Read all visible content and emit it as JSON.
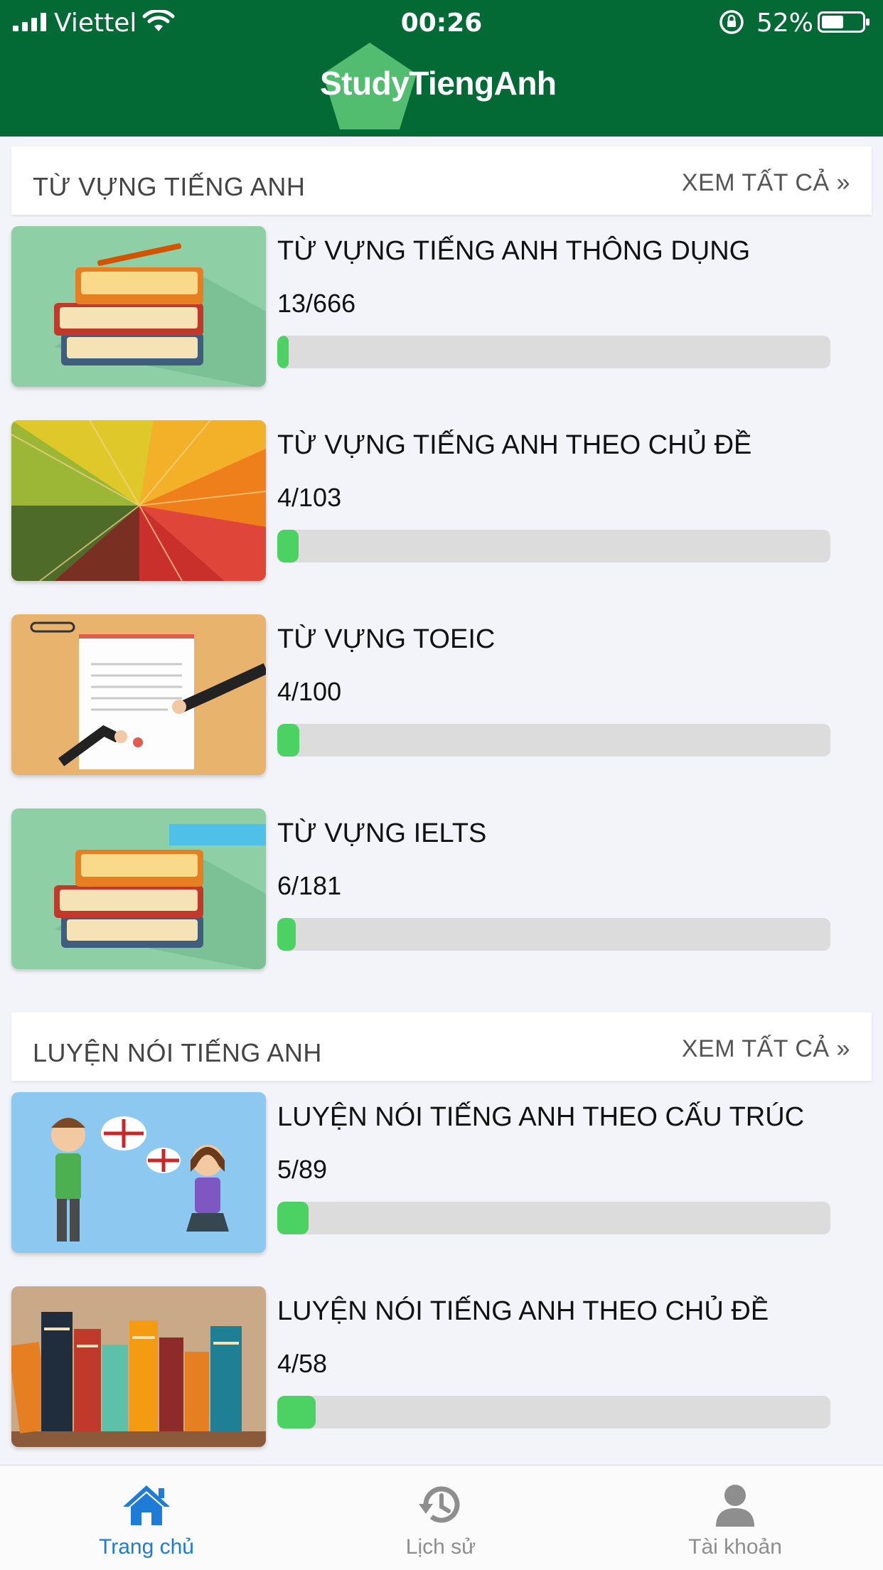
{
  "status_bar": {
    "carrier": "Viettel",
    "time": "00:26",
    "battery": "52%"
  },
  "header": {
    "logo_text": "StudyTiengAnh"
  },
  "sections": [
    {
      "title": "TỪ VỰNG TIẾNG ANH",
      "see_all": "XEM TẤT CẢ »",
      "items": [
        {
          "title": "TỪ VỰNG TIẾNG ANH THÔNG DỤNG",
          "count": "13/666",
          "progress": 0.0195,
          "image": "stacked-books"
        },
        {
          "title": "TỪ VỰNG TIẾNG ANH THEO CHỦ ĐỀ",
          "count": "4/103",
          "progress": 0.039,
          "image": "autumn-leaf"
        },
        {
          "title": "TỪ VỰNG TOEIC",
          "count": "4/100",
          "progress": 0.04,
          "image": "contract-signing"
        },
        {
          "title": "TỪ VỰNG IELTS",
          "count": "6/181",
          "progress": 0.033,
          "image": "ielts-books"
        }
      ]
    },
    {
      "title": "LUYỆN NÓI TIẾNG ANH",
      "see_all": "XEM TẤT CẢ »",
      "items": [
        {
          "title": "LUYỆN NÓI TIẾNG ANH THEO CẤU TRÚC",
          "count": "5/89",
          "progress": 0.056,
          "image": "people-talking"
        },
        {
          "title": "LUYỆN NÓI TIẾNG ANH THEO CHỦ ĐỀ",
          "count": "4/58",
          "progress": 0.069,
          "image": "books-shelf"
        }
      ]
    }
  ],
  "bottom_nav": [
    {
      "label": "Trang chủ",
      "icon": "home-icon",
      "active": true
    },
    {
      "label": "Lịch sử",
      "icon": "history-icon",
      "active": false
    },
    {
      "label": "Tài khoản",
      "icon": "account-icon",
      "active": false
    }
  ],
  "colors": {
    "header_bg": "#046a35",
    "progress_fill": "#4cd263",
    "progress_track": "#dcdcdc",
    "nav_active": "#1e7bd6",
    "nav_inactive": "#8e8e8e"
  }
}
